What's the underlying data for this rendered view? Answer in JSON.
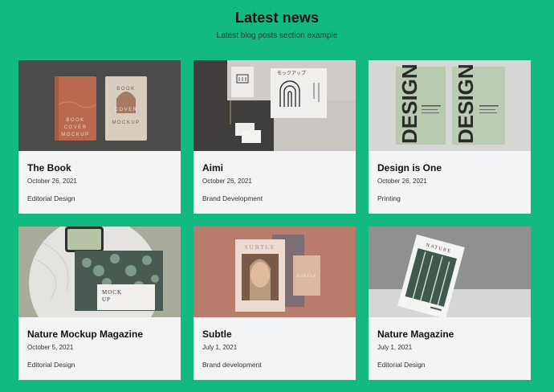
{
  "header": {
    "title": "Latest news",
    "subtitle": "Latest blog posts section example"
  },
  "posts": [
    {
      "title": "The Book",
      "date": "October 26, 2021",
      "category": "Editorial Design",
      "image": "book-cover-mockup"
    },
    {
      "title": "Aimi",
      "date": "October 26, 2021",
      "category": "Brand Development",
      "image": "stationery-mockup"
    },
    {
      "title": "Design is One",
      "date": "October 26, 2021",
      "category": "Printing",
      "image": "design-poster-mockup"
    },
    {
      "title": "Nature Mockup Magazine",
      "date": "October 5, 2021",
      "category": "Editorial Design",
      "image": "magazine-tablet-mockup"
    },
    {
      "title": "Subtle",
      "date": "July 1, 2021",
      "category": "Brand development",
      "image": "subtle-magazine-mockup"
    },
    {
      "title": "Nature Magazine",
      "date": "July 1, 2021",
      "category": "Editorial Design",
      "image": "nature-magazine-mockup"
    }
  ],
  "imagery": {
    "book_cover_text": [
      "BOOK",
      "COVER",
      "MOCKUP"
    ],
    "aimi_tag": "モックアップ",
    "design_text": "DESIGN",
    "mock_text": [
      "MOCK",
      "UP"
    ],
    "subtle_text": "SUBTLE",
    "nature_text": "NATURE"
  },
  "colors": {
    "background": "#12b981",
    "card": "#f3f4f6",
    "title": "#111111"
  }
}
